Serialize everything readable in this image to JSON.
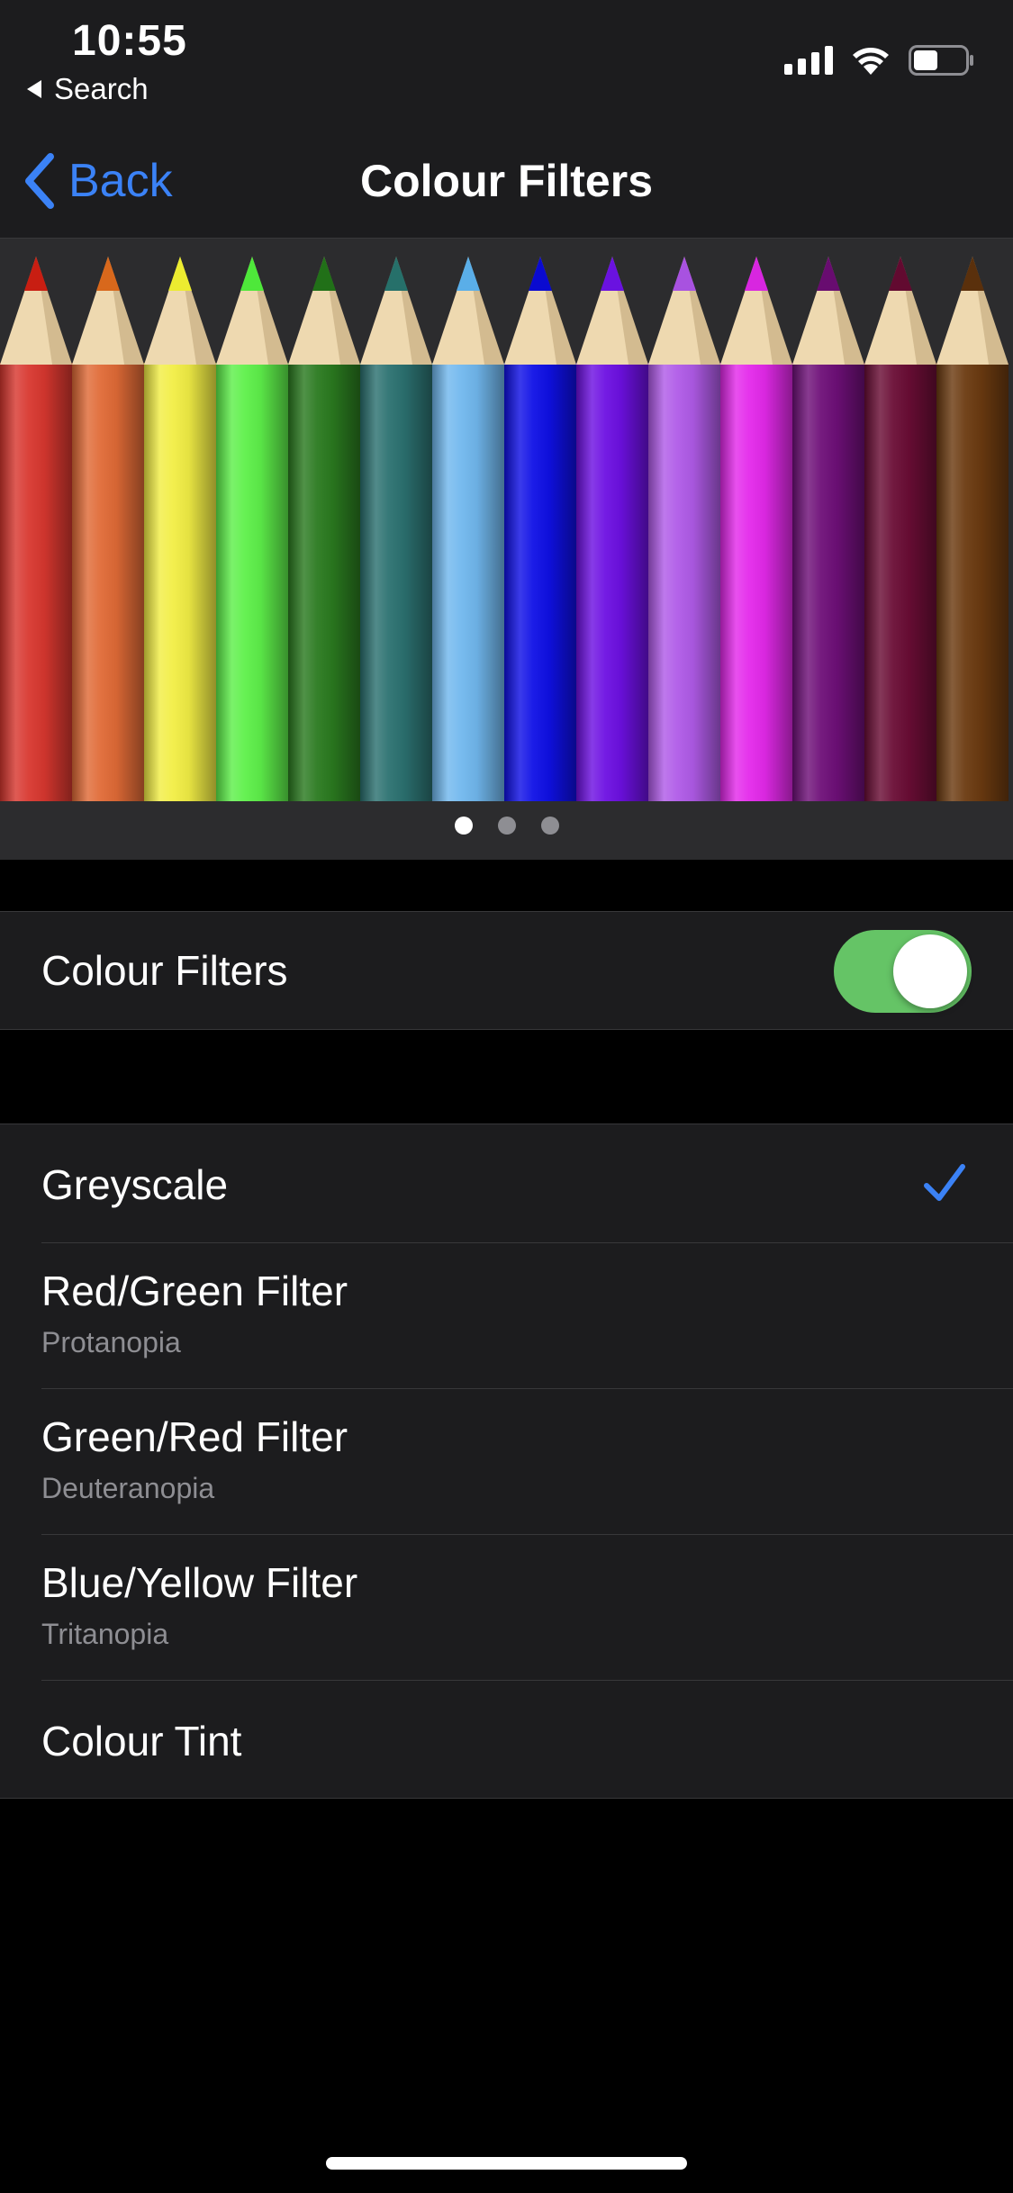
{
  "status_bar": {
    "time": "10:55",
    "back_app": "Search",
    "icons": [
      "cellular-signal-icon",
      "wifi-icon",
      "battery-icon"
    ]
  },
  "nav": {
    "back_label": "Back",
    "title": "Colour Filters"
  },
  "preview": {
    "pencil_colors": [
      "#d8372f",
      "#e06a36",
      "#f2ee45",
      "#5ef04a",
      "#2a7a1f",
      "#2b7170",
      "#71b8ee",
      "#0f10e6",
      "#6d10e2",
      "#b05be8",
      "#e429eb",
      "#6e0f78",
      "#6a0d35",
      "#6b3a10"
    ],
    "tip_colors": [
      "#c81e12",
      "#d8681c",
      "#ecec30",
      "#4ee83a",
      "#217018",
      "#26706a",
      "#5aaee8",
      "#0a0ad0",
      "#6a12e0",
      "#a852e0",
      "#d826e0",
      "#680c70",
      "#620a30",
      "#5a300c"
    ],
    "page_count": 3,
    "active_page": 1
  },
  "colour_filters_toggle": {
    "label": "Colour Filters",
    "enabled": true
  },
  "filters": [
    {
      "title": "Greyscale",
      "subtitle": "",
      "selected": true
    },
    {
      "title": "Red/Green Filter",
      "subtitle": "Protanopia",
      "selected": false
    },
    {
      "title": "Green/Red Filter",
      "subtitle": "Deuteranopia",
      "selected": false
    },
    {
      "title": "Blue/Yellow Filter",
      "subtitle": "Tritanopia",
      "selected": false
    },
    {
      "title": "Colour Tint",
      "subtitle": "",
      "selected": false
    }
  ],
  "colors": {
    "accent": "#3b82f6",
    "toggle_on": "#65c466",
    "background": "#000000",
    "cell": "#1c1c1e",
    "secondary_text": "#8e8e93"
  }
}
